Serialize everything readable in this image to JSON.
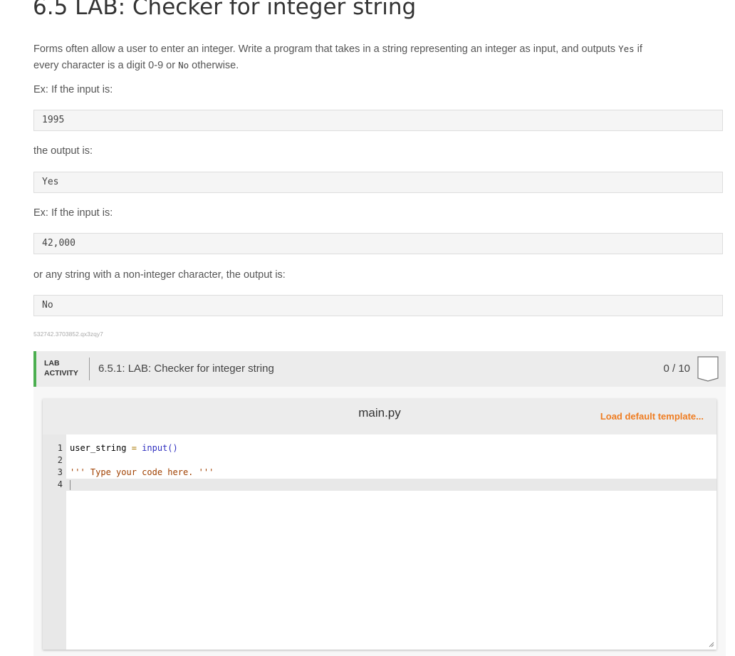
{
  "page": {
    "title": "6.5 LAB: Checker for integer string",
    "intro_pre": "Forms often allow a user to enter an integer. Write a program that takes in a string representing an integer as input, and outputs ",
    "intro_yes": "Yes",
    "intro_mid": " if",
    "intro_line2_pre": "every character is a digit 0-9 or ",
    "intro_no": "No",
    "intro_line2_post": " otherwise.",
    "ex1_label": "Ex: If the input is:",
    "ex1_input": "1995",
    "ex1_output_label": "the output is:",
    "ex1_output": "Yes",
    "ex2_label": "Ex: If the input is:",
    "ex2_input": "42,000",
    "ex2_output_label": "or any string with a non-integer character, the output is:",
    "ex2_output": "No",
    "identifier": "532742.3703852.qx3zqy7"
  },
  "lab": {
    "label_line1": "LAB",
    "label_line2": "ACTIVITY",
    "title": "6.5.1: LAB: Checker for integer string",
    "score": "0 / 10",
    "accent_color": "#4caf50"
  },
  "editor": {
    "filename": "main.py",
    "load_template": "Load default template...",
    "line_numbers": [
      "1",
      "2",
      "3",
      "4"
    ],
    "line1_var": "user_string",
    "line1_op": " = ",
    "line1_fn": "input()",
    "line3": "''' Type your code here. '''",
    "link_color": "#ef7d22"
  }
}
